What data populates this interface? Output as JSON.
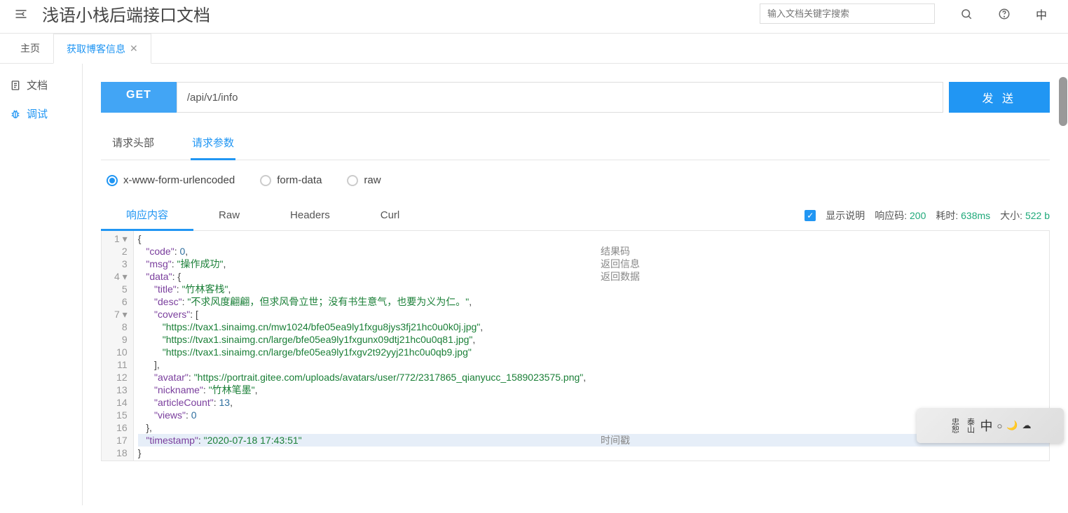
{
  "header": {
    "title": "浅语小栈后端接口文档",
    "search_placeholder": "输入文档关键字搜索",
    "lang": "中"
  },
  "tabs": [
    {
      "label": "主页",
      "active": false,
      "closable": false
    },
    {
      "label": "获取博客信息",
      "active": true,
      "closable": true
    }
  ],
  "sidebar": {
    "items": [
      {
        "label": "文档",
        "icon": "doc-icon"
      },
      {
        "label": "调试",
        "icon": "bug-icon",
        "active": true
      }
    ]
  },
  "request": {
    "method": "GET",
    "url": "/api/v1/info",
    "send_label": "发 送"
  },
  "param_tabs": [
    {
      "label": "请求头部"
    },
    {
      "label": "请求参数",
      "active": true
    }
  ],
  "body_encoding": {
    "options": [
      "x-www-form-urlencoded",
      "form-data",
      "raw"
    ],
    "selected": "x-www-form-urlencoded"
  },
  "response_tabs": [
    {
      "label": "响应内容",
      "active": true
    },
    {
      "label": "Raw"
    },
    {
      "label": "Headers"
    },
    {
      "label": "Curl"
    }
  ],
  "response_status": {
    "show_desc_label": "显示说明",
    "show_desc_checked": true,
    "code_label": "响应码:",
    "code_value": "200",
    "time_label": "耗时:",
    "time_value": "638ms",
    "size_label": "大小:",
    "size_value": "522 b"
  },
  "response_body": {
    "code": 0,
    "msg": "操作成功",
    "data": {
      "title": "竹林客栈",
      "desc": "不求风度翩翩，但求风骨立世；没有书生意气，也要为义为仁。",
      "covers": [
        "https://tvax1.sinaimg.cn/mw1024/bfe05ea9ly1fxgu8jys3fj21hc0u0k0j.jpg",
        "https://tvax1.sinaimg.cn/large/bfe05ea9ly1fxgunx09dtj21hc0u0q81.jpg",
        "https://tvax1.sinaimg.cn/large/bfe05ea9ly1fxgv2t92yyj21hc0u0qb9.jpg"
      ],
      "avatar": "https://portrait.gitee.com/uploads/avatars/user/772/2317865_qianyucc_1589023575.png",
      "nickname": "竹林笔墨",
      "articleCount": 13,
      "views": 0
    },
    "timestamp": "2020-07-18 17:43:51"
  },
  "annotations": {
    "line2": "结果码",
    "line3": "返回信息",
    "line4": "返回数据",
    "line17": "时间戳"
  },
  "float_widget": {
    "text_left": "忠恕",
    "text_mid": "泰山",
    "text_center": "中"
  }
}
